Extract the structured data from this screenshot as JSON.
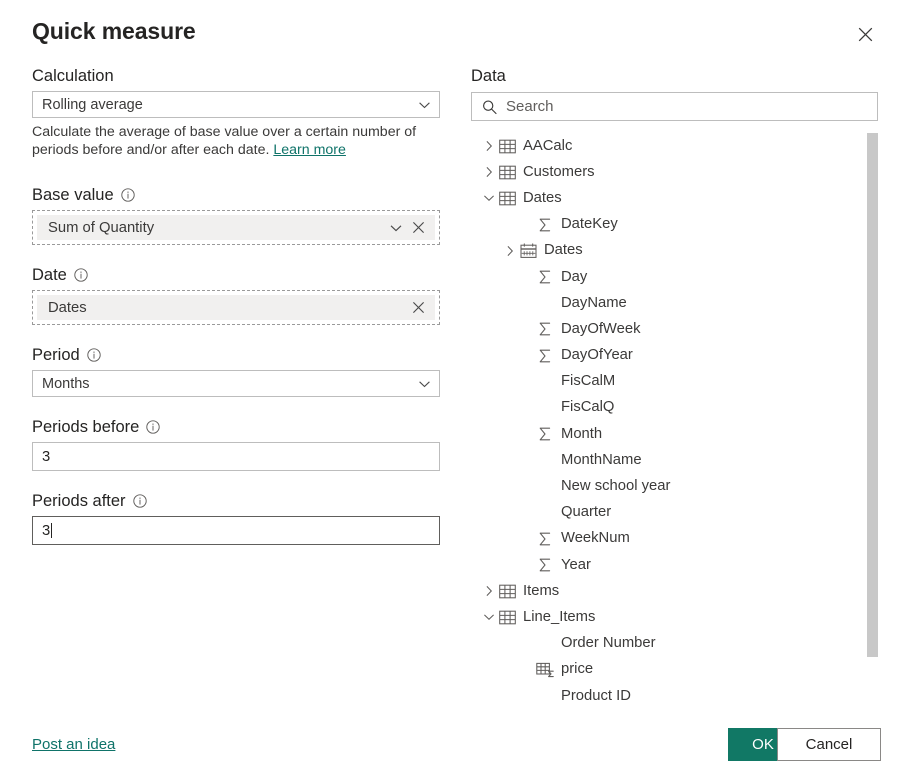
{
  "dialog": {
    "title": "Quick measure",
    "close_icon": "close-icon"
  },
  "calculation": {
    "label": "Calculation",
    "value": "Rolling average",
    "chevron_icon": "chevron-down-icon",
    "help_text": "Calculate the average of base value over a certain number of periods before and/or after each date. ",
    "help_link": "Learn more"
  },
  "base_value": {
    "label": "Base value",
    "info_icon": "info-icon",
    "value": "Sum of Quantity",
    "chevron_icon": "chevron-down-icon",
    "clear_icon": "close-icon"
  },
  "date": {
    "label": "Date",
    "info_icon": "info-icon",
    "value": "Dates",
    "clear_icon": "close-icon"
  },
  "period": {
    "label": "Period",
    "info_icon": "info-icon",
    "value": "Months",
    "chevron_icon": "chevron-down-icon"
  },
  "periods_before": {
    "label": "Periods before",
    "info_icon": "info-icon",
    "value": "3"
  },
  "periods_after": {
    "label": "Periods after",
    "info_icon": "info-icon",
    "value": "3",
    "focused": true
  },
  "data_panel": {
    "title": "Data",
    "search": {
      "placeholder": "Search",
      "value": "",
      "icon": "search-icon"
    },
    "tree": [
      {
        "label": "AACalc",
        "level": "table",
        "icon": "table-icon",
        "expander": "chevron-right-icon"
      },
      {
        "label": "Customers",
        "level": "table",
        "icon": "table-icon",
        "expander": "chevron-right-icon"
      },
      {
        "label": "Dates",
        "level": "table",
        "icon": "table-icon",
        "expander": "chevron-down-icon"
      },
      {
        "label": "DateKey",
        "level": "field",
        "icon": "sigma-icon",
        "expander": "none"
      },
      {
        "label": "Dates",
        "level": "fieldc",
        "icon": "calendar-icon",
        "expander": "chevron-right-icon"
      },
      {
        "label": "Day",
        "level": "field",
        "icon": "sigma-icon",
        "expander": "none"
      },
      {
        "label": "DayName",
        "level": "field",
        "icon": "none",
        "expander": "none"
      },
      {
        "label": "DayOfWeek",
        "level": "field",
        "icon": "sigma-icon",
        "expander": "none"
      },
      {
        "label": "DayOfYear",
        "level": "field",
        "icon": "sigma-icon",
        "expander": "none"
      },
      {
        "label": "FisCalM",
        "level": "field",
        "icon": "none",
        "expander": "none"
      },
      {
        "label": "FisCalQ",
        "level": "field",
        "icon": "none",
        "expander": "none"
      },
      {
        "label": "Month",
        "level": "field",
        "icon": "sigma-icon",
        "expander": "none"
      },
      {
        "label": "MonthName",
        "level": "field",
        "icon": "none",
        "expander": "none"
      },
      {
        "label": "New school year",
        "level": "field",
        "icon": "none",
        "expander": "none"
      },
      {
        "label": "Quarter",
        "level": "field",
        "icon": "none",
        "expander": "none"
      },
      {
        "label": "WeekNum",
        "level": "field",
        "icon": "sigma-icon",
        "expander": "none"
      },
      {
        "label": "Year",
        "level": "field",
        "icon": "sigma-icon",
        "expander": "none"
      },
      {
        "label": "Items",
        "level": "table",
        "icon": "table-icon",
        "expander": "chevron-right-icon"
      },
      {
        "label": "Line_Items",
        "level": "table",
        "icon": "table-icon",
        "expander": "chevron-down-icon"
      },
      {
        "label": "Order Number",
        "level": "field",
        "icon": "none",
        "expander": "none"
      },
      {
        "label": "price",
        "level": "field",
        "icon": "measure-icon",
        "expander": "none"
      },
      {
        "label": "Product ID",
        "level": "field",
        "icon": "none",
        "expander": "none"
      }
    ],
    "scrollbar": {
      "visible": true
    }
  },
  "footer": {
    "post_idea": "Post an idea",
    "ok": "OK",
    "cancel": "Cancel"
  },
  "colors": {
    "accent": "#117865",
    "link": "#0f7369",
    "chip_bg": "#f1f0ef",
    "border": "#bdbdbd",
    "text": "#323130"
  }
}
